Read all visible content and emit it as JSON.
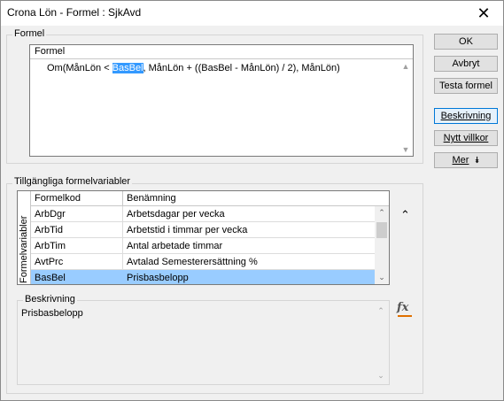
{
  "window": {
    "title": "Crona Lön - Formel : SjkAvd",
    "close_glyph": "✕"
  },
  "formula_group": {
    "label": "Formel",
    "header": "Formel",
    "text_before": "Om(MånLön < ",
    "text_selected": "BasBel",
    "text_after": ", MånLön + ((BasBel - MånLön) / 2), MånLön)"
  },
  "buttons": {
    "ok": "OK",
    "cancel": "Avbryt",
    "test": "Testa formel",
    "describe": "Beskrivning",
    "new_condition": "Nytt villkor",
    "more": "Mer",
    "more_icon": "⯯"
  },
  "variables_group": {
    "label": "Tillgängliga formelvariabler",
    "side_label": "Formelvariabler",
    "columns": [
      "Formelkod",
      "Benämning"
    ],
    "rows": [
      {
        "code": "ArbDgr",
        "name": "Arbetsdagar per vecka"
      },
      {
        "code": "ArbTid",
        "name": "Arbetstid i timmar per vecka"
      },
      {
        "code": "ArbTim",
        "name": "Antal arbetade timmar"
      },
      {
        "code": "AvtPrc",
        "name": "Avtalad Semesterersättning %"
      },
      {
        "code": "BasBel",
        "name": "Prisbasbelopp"
      }
    ],
    "selected_row": 4,
    "collapse_icon": "⌃"
  },
  "description": {
    "label": "Beskrivning",
    "text": "Prisbasbelopp",
    "fx_icon": "fx"
  },
  "colors": {
    "selection": "#3399ff",
    "row_selected": "#99ccff",
    "accent_border": "#0078d7"
  }
}
